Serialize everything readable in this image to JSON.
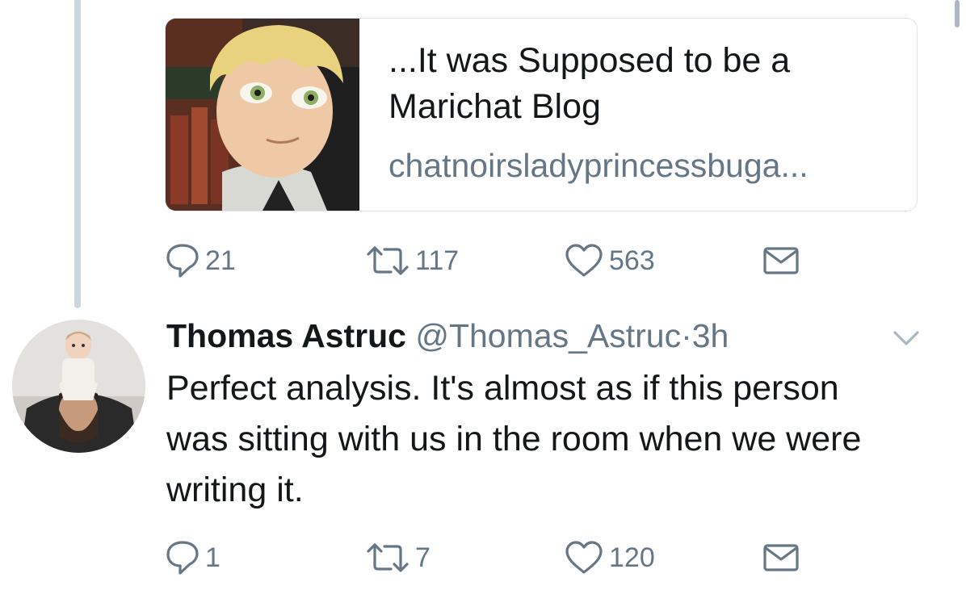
{
  "card": {
    "title": "...It was Supposed to be a Marichat Blog",
    "domain": "chatnoirsladyprincessbuga..."
  },
  "prev_tweet_actions": {
    "replies": "21",
    "retweets": "117",
    "likes": "563"
  },
  "reply_tweet": {
    "name": "Thomas Astruc",
    "handle": "@Thomas_Astruc",
    "separator": "·",
    "time": "3h",
    "text": "Perfect analysis. It's almost as if this person was sitting with us in the room when we were writing it.",
    "actions": {
      "replies": "1",
      "retweets": "7",
      "likes": "120"
    }
  },
  "colors": {
    "text_primary": "#14171a",
    "text_secondary": "#657786",
    "thread_line": "#ccd6dd",
    "card_border": "#dde3e8"
  },
  "icons": [
    "reply-icon",
    "retweet-icon",
    "like-icon",
    "direct-message-icon",
    "chevron-down-icon"
  ]
}
